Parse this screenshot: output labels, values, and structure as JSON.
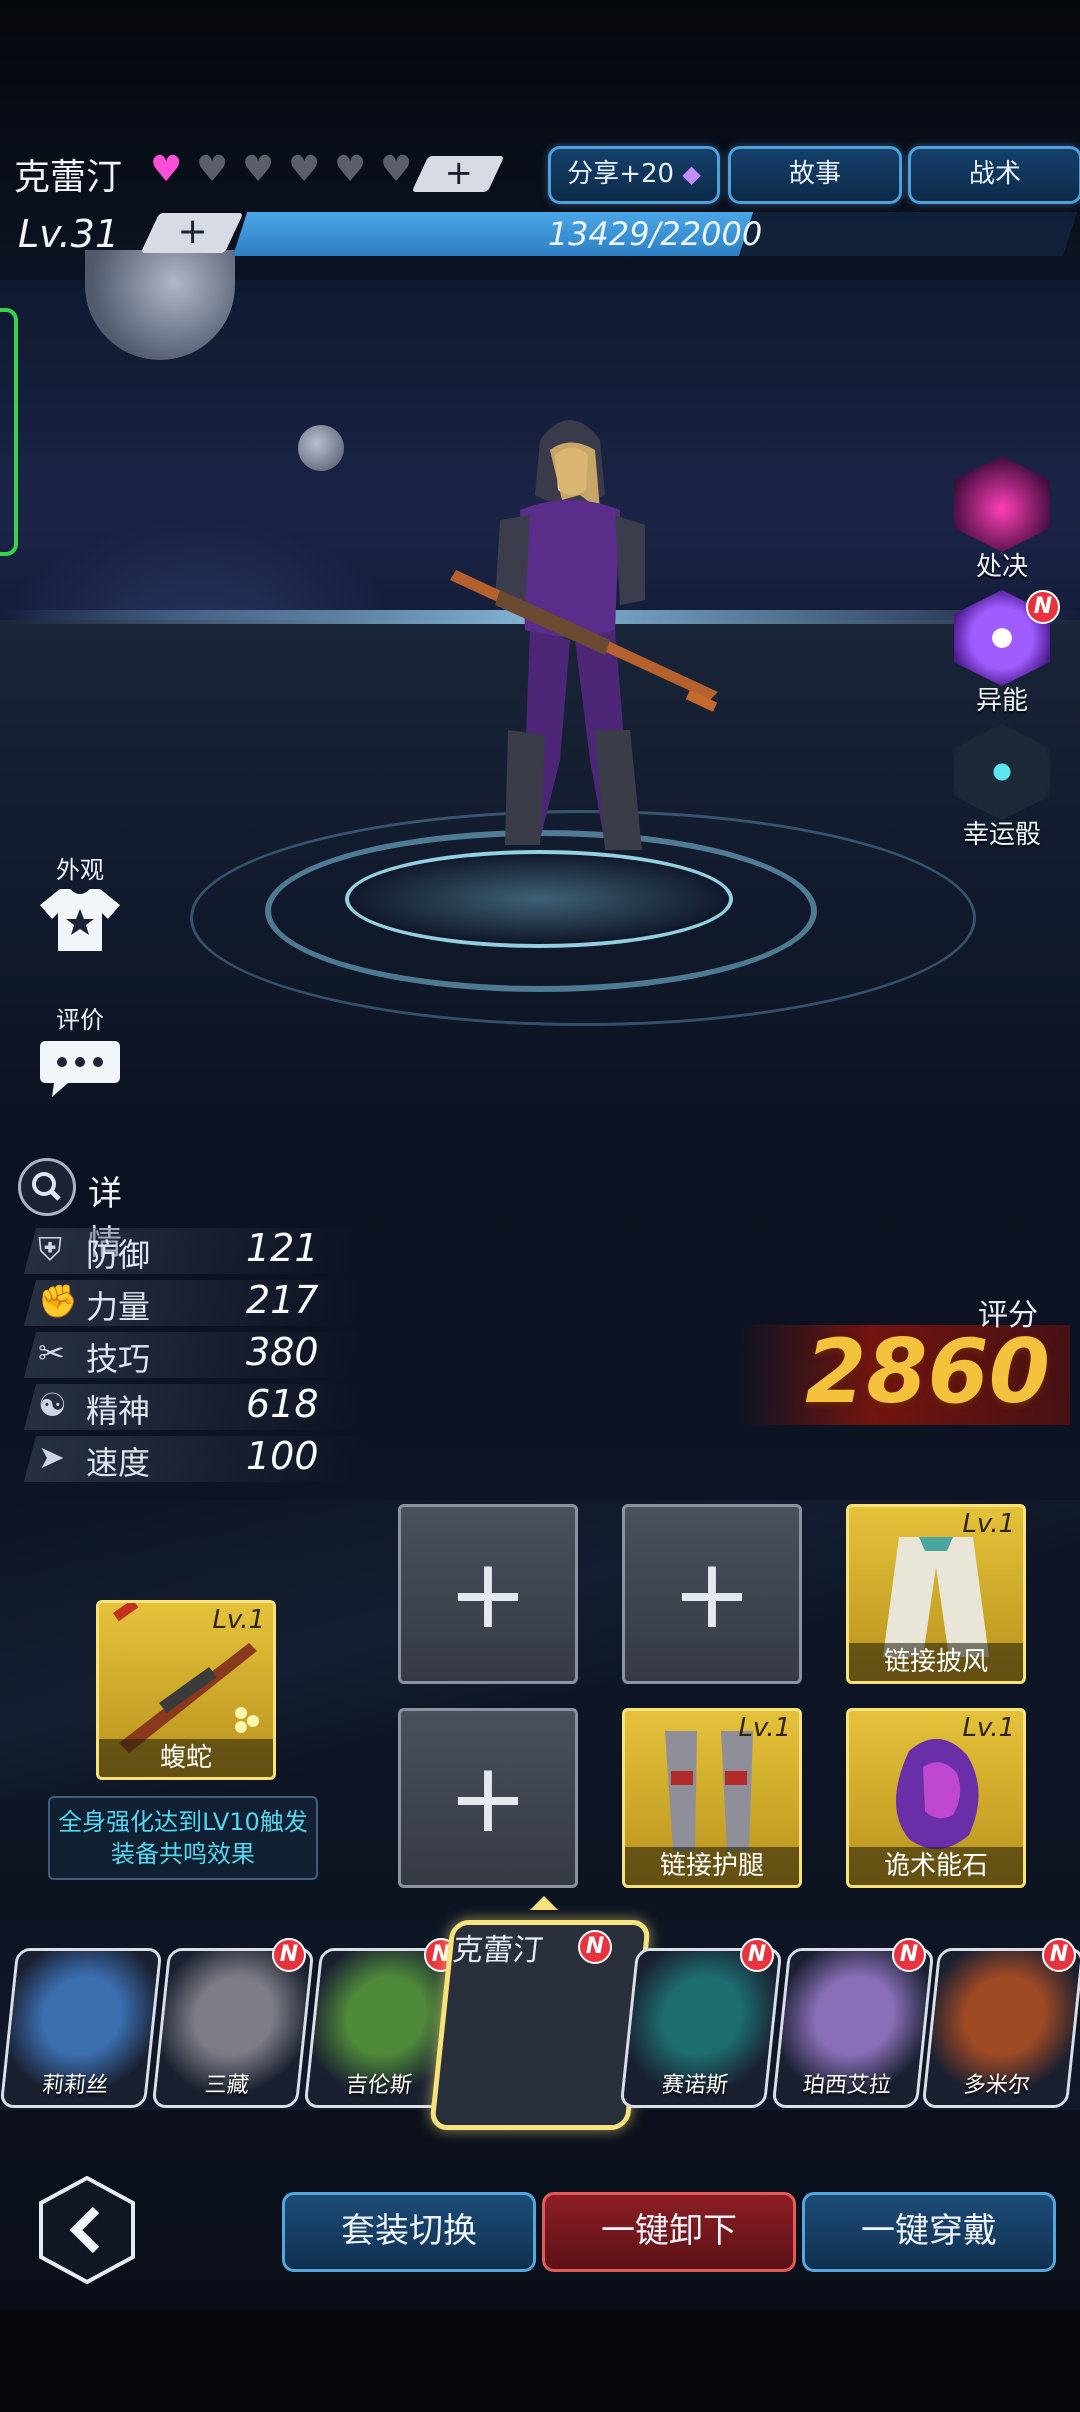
{
  "header": {
    "character_name": "克蕾汀",
    "hearts_filled": 1,
    "hearts_total": 6,
    "heart_add_label": "+",
    "share_button": "分享+20",
    "story_button": "故事",
    "tactics_button": "战术",
    "level_label": "Lv.31",
    "level_plus": "+",
    "xp_text": "13429/22000",
    "xp_fraction": 0.61
  },
  "skills": [
    {
      "label": "处决",
      "icon": "execute-icon",
      "badge": ""
    },
    {
      "label": "异能",
      "icon": "ability-icon",
      "badge": "N"
    },
    {
      "label": "幸运骰",
      "icon": "dice-icon",
      "badge": ""
    }
  ],
  "side_buttons": {
    "appearance": "外观",
    "review": "评价"
  },
  "details": {
    "label": "详情",
    "stats": [
      {
        "name": "防御",
        "value": "121",
        "icon": "shield-icon"
      },
      {
        "name": "力量",
        "value": "217",
        "icon": "fist-icon"
      },
      {
        "name": "技巧",
        "value": "380",
        "icon": "tools-icon"
      },
      {
        "name": "精神",
        "value": "618",
        "icon": "mind-icon"
      },
      {
        "name": "速度",
        "value": "100",
        "icon": "speed-icon"
      }
    ],
    "score_label": "评分",
    "score_value": "2860"
  },
  "equipment": {
    "weapon": {
      "name": "蝮蛇",
      "level": "Lv.1"
    },
    "cape": {
      "name": "链接披风",
      "level": "Lv.1"
    },
    "legs": {
      "name": "链接护腿",
      "level": "Lv.1"
    },
    "stone": {
      "name": "诡术能石",
      "level": "Lv.1"
    },
    "empty_plus": "+",
    "resonance_text": "全身强化达到LV10触发装备共鸣效果"
  },
  "roster": [
    {
      "name": "莉莉丝",
      "badge": ""
    },
    {
      "name": "三藏",
      "badge": "N"
    },
    {
      "name": "吉伦斯",
      "badge": "N"
    },
    {
      "name": "克蕾汀",
      "badge": "N",
      "selected": true
    },
    {
      "name": "赛诺斯",
      "badge": "N"
    },
    {
      "name": "珀西艾拉",
      "badge": "N"
    },
    {
      "name": "多米尔",
      "badge": "N"
    }
  ],
  "bottom": {
    "back": "‹",
    "suit_switch": "套装切换",
    "unequip_all": "一键卸下",
    "equip_all": "一键穿戴"
  },
  "colors": {
    "accent_blue": "#4f9fd8",
    "score_gold": "#f5c23e",
    "heart_pink": "#ff4fd6",
    "badge_red": "#e8333f"
  }
}
